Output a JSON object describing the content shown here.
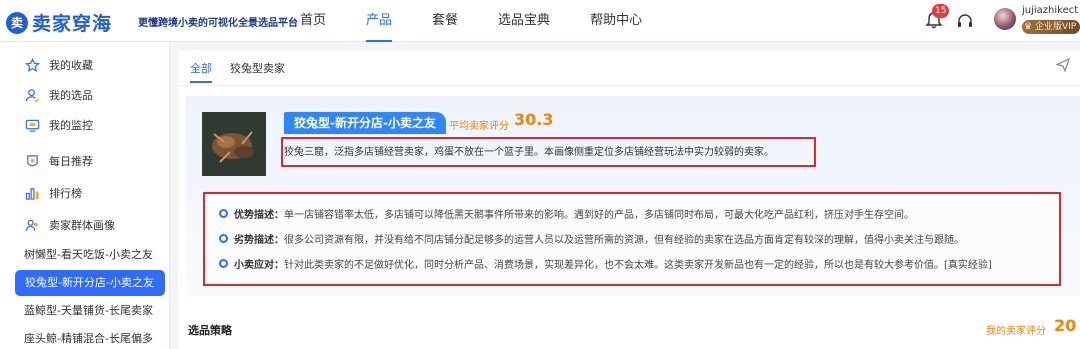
{
  "brand": {
    "logo_mark": "卖",
    "logo_text": "卖家穿海",
    "slogan": "更懂跨境小卖的可视化全景选品平台"
  },
  "nav": [
    "首页",
    "产品",
    "套餐",
    "选品宝典",
    "帮助中心"
  ],
  "nav_active": "产品",
  "header": {
    "bell_icon": "bell-icon",
    "notification_count": "15",
    "support_icon": "headset-icon",
    "username": "jujiazhikect",
    "vip_label": "企业版VIP"
  },
  "sidebar": {
    "items": [
      {
        "label": "我的收藏",
        "icon": "star-icon"
      },
      {
        "label": "我的选品",
        "icon": "user-check-icon"
      },
      {
        "label": "我的监控",
        "icon": "monitor-icon"
      },
      {
        "label": "每日推荐",
        "icon": "calendar-badge-icon"
      },
      {
        "label": "排行榜",
        "icon": "bar-chart-icon"
      },
      {
        "label": "卖家群体画像",
        "icon": "users-icon"
      }
    ],
    "sub_items": [
      "树懒型-看天吃饭-小卖之友",
      "狡兔型-新开分店-小卖之友",
      "蓝鲸型-天量铺货-长尾卖家",
      "座头鲸-精铺混合-长尾偏多"
    ],
    "active_sub": "狡兔型-新开分店-小卖之友"
  },
  "tabs": [
    "全部",
    "狡兔型卖家"
  ],
  "tab_active": "全部",
  "card": {
    "type_tag": "狡兔型-新开分店-小卖之友",
    "avg_score_label": "平均卖家评分",
    "avg_score_value": "30.3",
    "description": "狡兔三窟，泛指多店铺经营卖家，鸡蛋不放在一个篮子里。本画像侧重定位多店铺经营玩法中实力较弱的卖家。",
    "analysis": [
      {
        "label": "优势描述：",
        "text": "单一店铺容错率太低，多店铺可以降低黑天鹅事件所带来的影响。遇到好的产品，多店铺同时布局，可最大化吃产品红利，挤压对手生存空间。"
      },
      {
        "label": "劣势描述：",
        "text": "很多公司资源有限，并没有给不同店铺分配足够多的运营人员以及运营所需的资源，但有经验的卖家在选品方面肯定有较深的理解，值得小卖关注与跟随。"
      },
      {
        "label": "小卖应对：",
        "text": "针对此类卖家的不足做好优化，同时分析产品、消费场景，实现差异化，也不会太难。这类卖家开发新品也有一定的经验，所以也是有较大参考价值。[真实经验]"
      }
    ]
  },
  "strategy": {
    "title": "选品策略",
    "my_score_label": "我的卖家评分",
    "my_score_value": "20"
  },
  "colors": {
    "primary": "#2f6bff",
    "accent": "#f5820a",
    "highlight_border": "#e3262b"
  }
}
